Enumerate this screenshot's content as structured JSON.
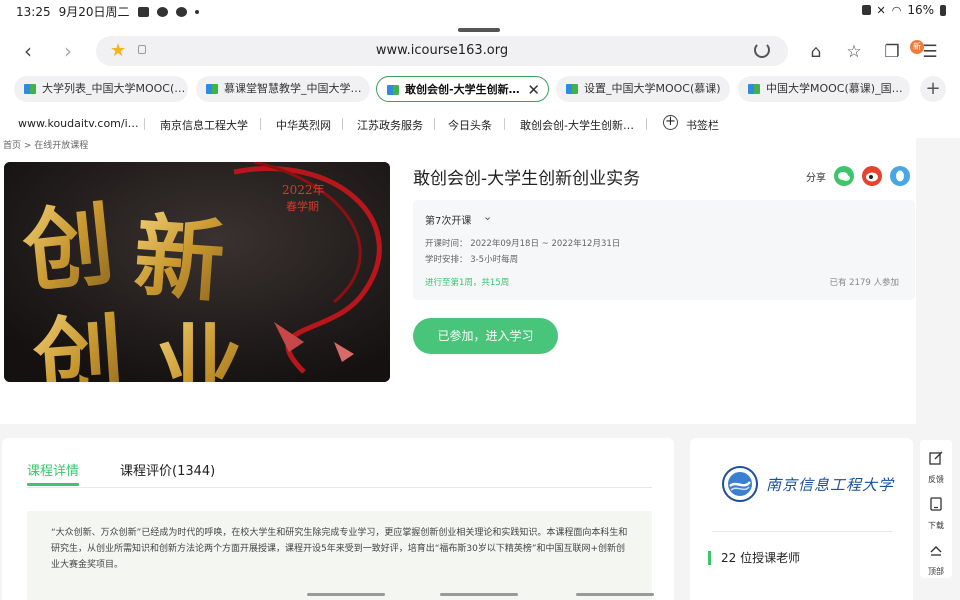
{
  "status_bar": {
    "time": "13:25",
    "date": "9月20日周二",
    "battery": "16%"
  },
  "browser": {
    "url": "www.icourse163.org",
    "menu_badge": "新",
    "tabs": [
      {
        "label": "大学列表_中国大学MOOC(…"
      },
      {
        "label": "慕课堂智慧教学_中国大学…"
      },
      {
        "label": "敢创会创-大学生创新…",
        "active": true
      },
      {
        "label": "设置_中国大学MOOC(慕课)"
      },
      {
        "label": "中国大学MOOC(慕课)_国…"
      }
    ],
    "bookmarks": [
      "www.koudaitv.com/i…",
      "南京信息工程大学",
      "中华英烈网",
      "江苏政务服务",
      "今日头条",
      "敢创会创-大学生创新…",
      "书签栏"
    ]
  },
  "page": {
    "breadcrumb": "首页 > 在线开放课程",
    "cover": {
      "year_text": "2022年",
      "term_text": "春学期",
      "big_chars": [
        "创",
        "新",
        "创",
        "业"
      ]
    },
    "course_title": "敢创会创-大学生创新创业实务",
    "share_label": "分享",
    "term_select": "第7次开课",
    "schedule": "开课时间： 2022年09月18日 ~ 2022年12月31日",
    "workload": "学时安排： 3-5小时每周",
    "progress": "进行至第1周，共15周",
    "joined": "已有 2179 人参加",
    "enter_button": "已参加，进入学习",
    "tab_detail": "课程详情",
    "tab_review": "课程评价(1344)",
    "intro": "“大众创新、万众创新”已经成为时代的呼唤，在校大学生和研究生除完成专业学习，更应掌握创新创业相关理论和实践知识。本课程面向本科生和研究生，从创业所需知识和创新方法论两个方面开展授课，课程开设5年来受到一致好评，培育出“福布斯30岁以下精英榜”和中国互联网+创新创业大赛金奖项目。",
    "school_name": "南京信息工程大学",
    "teachers": "22 位授课老师"
  },
  "float_bar": {
    "feedback": "反馈",
    "download": "下载",
    "top": "顶部"
  },
  "colors": {
    "accent_green": "#3ec46d",
    "button_green": "#49c47b",
    "tab_active_border": "#3f9f60",
    "school_blue": "#1b4f9c"
  }
}
